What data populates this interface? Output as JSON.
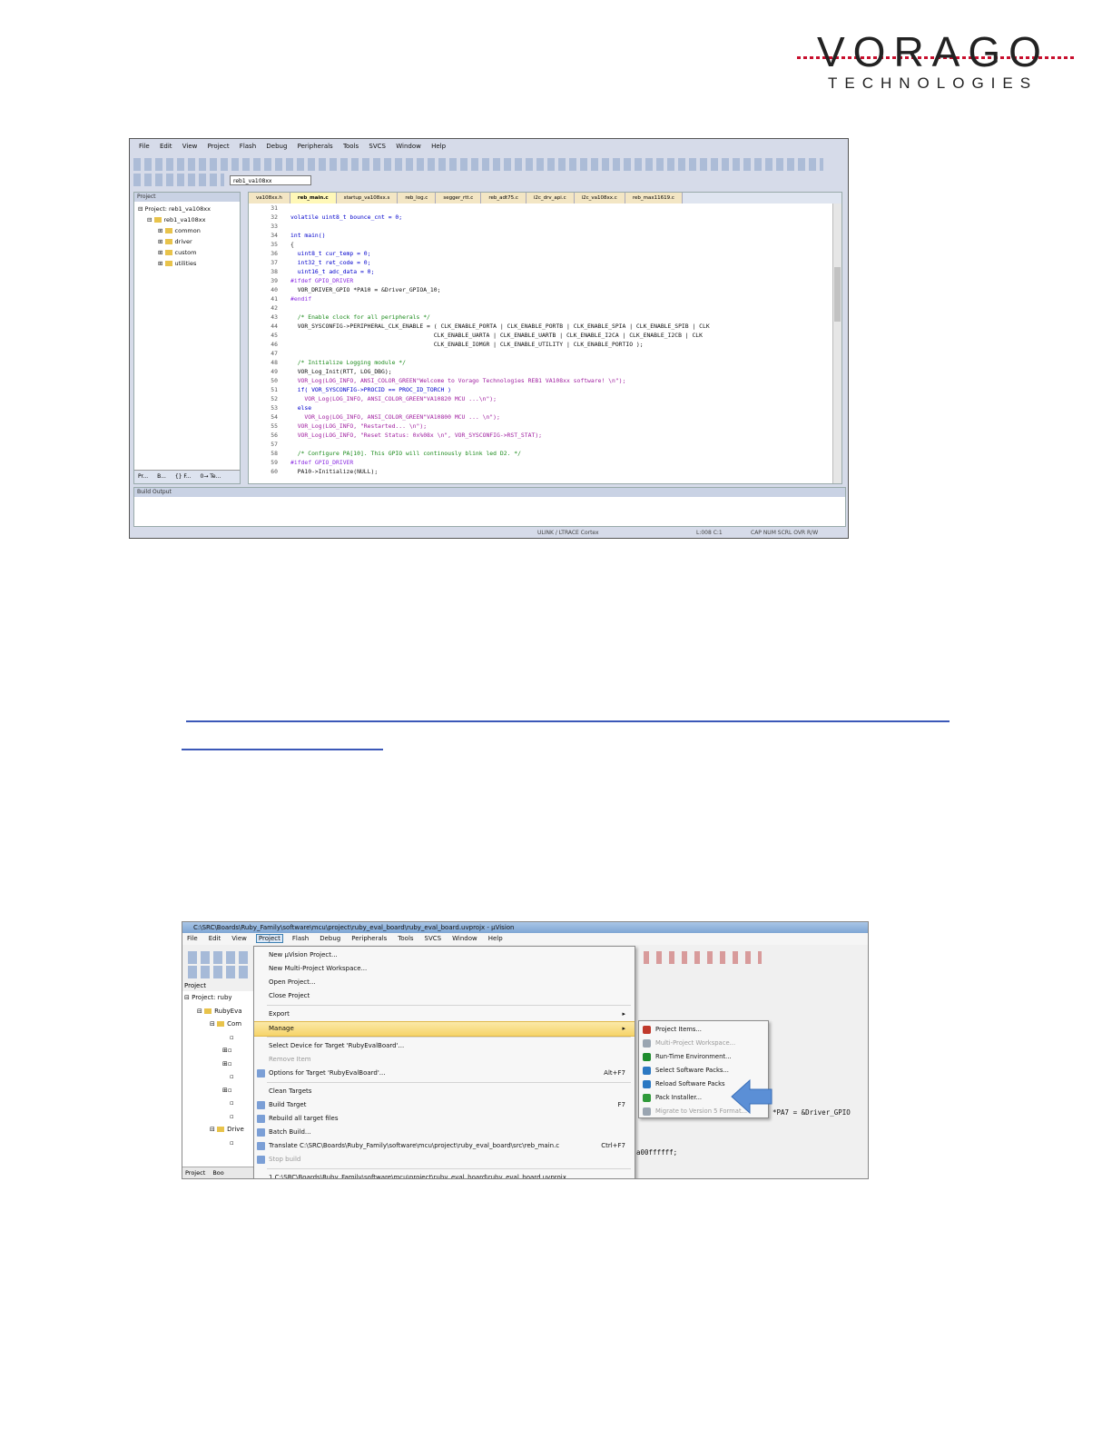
{
  "logo": {
    "wordmark": "VORAGO",
    "subtitle": "TECHNOLOGIES"
  },
  "ide": {
    "menu": [
      "File",
      "Edit",
      "View",
      "Project",
      "Flash",
      "Debug",
      "Peripherals",
      "Tools",
      "SVCS",
      "Window",
      "Help"
    ],
    "target": "reb1_va108xx",
    "project_panel": {
      "title": "Project",
      "items": [
        "Project: reb1_va108xx",
        "reb1_va108xx",
        "common",
        "driver",
        "custom",
        "utilities"
      ],
      "tabs": [
        "Pr...",
        "B...",
        "{} F...",
        "0→ Te..."
      ]
    },
    "file_tabs": [
      "va108xx.h",
      "reb_main.c",
      "startup_va108xx.s",
      "reb_log.c",
      "segger_rtt.c",
      "reb_adt75.c",
      "i2c_drv_api.c",
      "i2c_va108xx.c",
      "reb_max11619.c"
    ],
    "code_lines": [
      {
        "n": "31",
        "t": ""
      },
      {
        "n": "32",
        "t": "volatile uint8_t bounce_cnt = 0;"
      },
      {
        "n": "33",
        "t": ""
      },
      {
        "n": "34",
        "t": "int main()"
      },
      {
        "n": "35",
        "t": "{"
      },
      {
        "n": "36",
        "t": "  uint8_t cur_temp = 0;"
      },
      {
        "n": "37",
        "t": "  int32_t ret_code = 0;"
      },
      {
        "n": "38",
        "t": "  uint16_t adc_data = 0;"
      },
      {
        "n": "39",
        "t": "#ifdef GPIO_DRIVER"
      },
      {
        "n": "40",
        "t": "  VOR_DRIVER_GPIO *PA10 = &Driver_GPIOA_10;"
      },
      {
        "n": "41",
        "t": "#endif"
      },
      {
        "n": "42",
        "t": ""
      },
      {
        "n": "43",
        "t": "  /* Enable clock for all peripherals */"
      },
      {
        "n": "44",
        "t": "  VOR_SYSCONFIG->PERIPHERAL_CLK_ENABLE = ( CLK_ENABLE_PORTA | CLK_ENABLE_PORTB | CLK_ENABLE_SPIA | CLK_ENABLE_SPIB | CLK"
      },
      {
        "n": "45",
        "t": "                                         CLK_ENABLE_UARTA | CLK_ENABLE_UARTB | CLK_ENABLE_I2CA | CLK_ENABLE_I2CB | CLK"
      },
      {
        "n": "46",
        "t": "                                         CLK_ENABLE_IOMGR | CLK_ENABLE_UTILITY | CLK_ENABLE_PORTIO );"
      },
      {
        "n": "47",
        "t": ""
      },
      {
        "n": "48",
        "t": "  /* Initialize Logging module */"
      },
      {
        "n": "49",
        "t": "  VOR_Log_Init(RTT, LOG_DBG);"
      },
      {
        "n": "50",
        "t": "  VOR_Log(LOG_INFO, ANSI_COLOR_GREEN\"Welcome to Vorago Technologies REB1 VA108xx software! \\n\");"
      },
      {
        "n": "51",
        "t": "  if( VOR_SYSCONFIG->PROCID == PROC_ID_TORCH )"
      },
      {
        "n": "52",
        "t": "    VOR_Log(LOG_INFO, ANSI_COLOR_GREEN\"VA10820 MCU ...\\n\");"
      },
      {
        "n": "53",
        "t": "  else"
      },
      {
        "n": "54",
        "t": "    VOR_Log(LOG_INFO, ANSI_COLOR_GREEN\"VA10800 MCU ... \\n\");"
      },
      {
        "n": "55",
        "t": "  VOR_Log(LOG_INFO, \"Restarted... \\n\");"
      },
      {
        "n": "56",
        "t": "  VOR_Log(LOG_INFO, \"Reset Status: 0x%08x \\n\", VOR_SYSCONFIG->RST_STAT);"
      },
      {
        "n": "57",
        "t": ""
      },
      {
        "n": "58",
        "t": "  /* Configure PA[10]. This GPIO will continously blink led D2. */"
      },
      {
        "n": "59",
        "t": "#ifdef GPIO_DRIVER"
      },
      {
        "n": "60",
        "t": "  PA10->Initialize(NULL);"
      }
    ],
    "build_output_title": "Build Output",
    "status": {
      "debugger": "ULINK / LTRACE Cortex",
      "pos": "L:008 C:1",
      "flags": "CAP NUM SCRL OVR R/W"
    }
  },
  "uvision": {
    "title": "C:\\SRC\\Boards\\Ruby_Family\\software\\mcu\\project\\ruby_eval_board\\ruby_eval_board.uvprojx - µVision",
    "menu": [
      "File",
      "Edit",
      "View",
      "Project",
      "Flash",
      "Debug",
      "Peripherals",
      "Tools",
      "SVCS",
      "Window",
      "Help"
    ],
    "project_label": "Project",
    "tree": [
      "Project: ruby",
      "RubyEva",
      "Com",
      "",
      "",
      "",
      "",
      "",
      "",
      "",
      "Drive",
      "",
      ""
    ],
    "bottom_tabs": [
      "Project",
      "Boo"
    ],
    "project_menu": [
      {
        "label": "New µVision Project...",
        "shortcut": "",
        "state": "normal"
      },
      {
        "label": "New Multi-Project Workspace...",
        "shortcut": "",
        "state": "normal"
      },
      {
        "label": "Open Project...",
        "shortcut": "",
        "state": "normal"
      },
      {
        "label": "Close Project",
        "shortcut": "",
        "state": "normal"
      },
      {
        "label": "Export",
        "shortcut": "▸",
        "state": "normal"
      },
      {
        "label": "Manage",
        "shortcut": "▸",
        "state": "highlight"
      },
      {
        "label": "Select Device for Target 'RubyEvalBoard'...",
        "shortcut": "",
        "state": "normal"
      },
      {
        "label": "Remove Item",
        "shortcut": "",
        "state": "disabled"
      },
      {
        "label": "Options for Target 'RubyEvalBoard'...",
        "shortcut": "Alt+F7",
        "state": "normal"
      },
      {
        "label": "Clean Targets",
        "shortcut": "",
        "state": "normal"
      },
      {
        "label": "Build Target",
        "shortcut": "F7",
        "state": "normal"
      },
      {
        "label": "Rebuild all target files",
        "shortcut": "",
        "state": "normal"
      },
      {
        "label": "Batch Build...",
        "shortcut": "",
        "state": "normal"
      },
      {
        "label": "Translate C:\\SRC\\Boards\\Ruby_Family\\software\\mcu\\project\\ruby_eval_board\\src\\reb_main.c",
        "shortcut": "Ctrl+F7",
        "state": "normal"
      },
      {
        "label": "Stop build",
        "shortcut": "",
        "state": "disabled"
      },
      {
        "label": "1 C:\\SRC\\Boards\\Ruby_Family\\software\\mcu\\project\\ruby_eval_board\\ruby_eval_board.uvprojx",
        "shortcut": "",
        "state": "normal"
      }
    ],
    "manage_submenu": [
      {
        "label": "Project Items...",
        "state": "normal",
        "color": "#c0392b"
      },
      {
        "label": "Multi-Project Workspace...",
        "state": "disabled",
        "color": "#9aa5b1"
      },
      {
        "label": "Run-Time Environment...",
        "state": "normal",
        "color": "#1e8c2e"
      },
      {
        "label": "Select Software Packs...",
        "state": "normal",
        "color": "#2b78c2"
      },
      {
        "label": "Reload Software Packs",
        "state": "normal",
        "color": "#2b78c2"
      },
      {
        "label": "Pack Installer...",
        "state": "normal",
        "color": "#2f9a3a"
      },
      {
        "label": "Migrate to Version 5 Format...",
        "state": "disabled",
        "color": "#9aa5b1"
      }
    ],
    "bg_code": [
      "*PA7 = &Driver_GPIO",
      "a00ffffff;"
    ],
    "arrow_color": "#5b8fd6"
  }
}
